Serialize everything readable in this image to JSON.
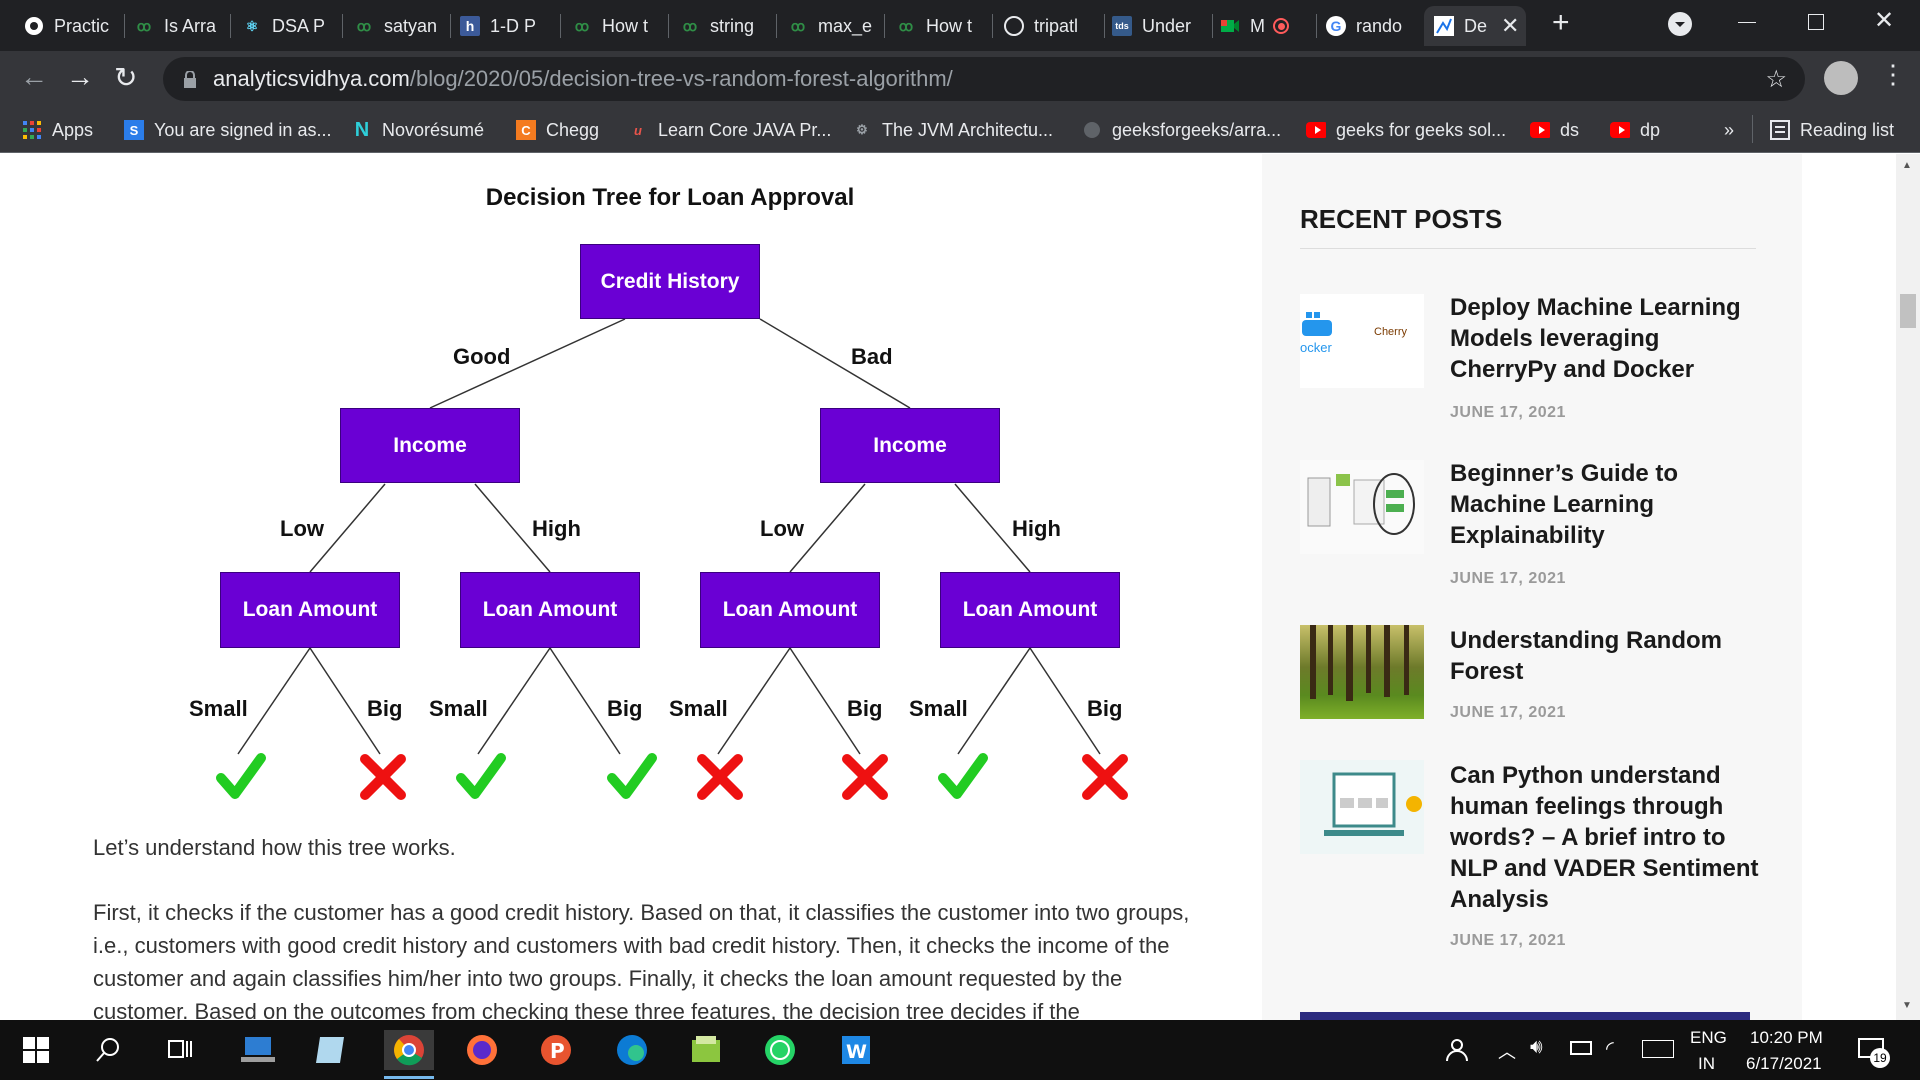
{
  "tabs": [
    {
      "label": "Practic",
      "icon": "globe-icon"
    },
    {
      "label": "Is Arra",
      "icon": "gfg-icon"
    },
    {
      "label": "DSA P",
      "icon": "react-icon"
    },
    {
      "label": "satyan",
      "icon": "gfg-icon"
    },
    {
      "label": "1-D P",
      "icon": "h-icon"
    },
    {
      "label": "How t",
      "icon": "gfg-icon"
    },
    {
      "label": "string",
      "icon": "gfg-icon"
    },
    {
      "label": "max_e",
      "icon": "gfg-icon"
    },
    {
      "label": "How t",
      "icon": "gfg-icon"
    },
    {
      "label": "tripatl",
      "icon": "github-icon"
    },
    {
      "label": "Under",
      "icon": "tds-icon"
    },
    {
      "label": "M",
      "icon": "meet-icon"
    },
    {
      "label": "rando",
      "icon": "google-icon"
    },
    {
      "label": "De",
      "icon": "analytics-icon"
    }
  ],
  "new_tab_symbol": "+",
  "url": {
    "host": "analyticsvidhya.com",
    "path": "/blog/2020/05/decision-tree-vs-random-forest-algorithm/"
  },
  "bookmarks": [
    {
      "label": "Apps"
    },
    {
      "label": "You are signed in as..."
    },
    {
      "label": "Novorésumé"
    },
    {
      "label": "Chegg"
    },
    {
      "label": "Learn Core JAVA Pr..."
    },
    {
      "label": "The JVM Architectu..."
    },
    {
      "label": "geeksforgeeks/arra..."
    },
    {
      "label": "geeks for geeks sol..."
    },
    {
      "label": "ds"
    },
    {
      "label": "dp"
    }
  ],
  "bookmarks_overflow": "»",
  "reading_list": "Reading list",
  "diagram": {
    "title": "Decision Tree for Loan Approval",
    "root": "Credit History",
    "edge_good": "Good",
    "edge_bad": "Bad",
    "income": "Income",
    "low": "Low",
    "high": "High",
    "loan_amount": "Loan Amount",
    "small": "Small",
    "big": "Big",
    "outcomes": [
      "approve",
      "reject",
      "approve",
      "approve",
      "reject",
      "reject",
      "approve",
      "reject"
    ],
    "colors": {
      "node": "#6a00d4",
      "approve": "#22cc22",
      "reject": "#ee1111"
    }
  },
  "article": {
    "para1": "Let’s understand how this tree works.",
    "para2": "First, it checks if the customer has a good credit history. Based on that, it classifies the customer into two groups, i.e., customers with good credit history and customers with bad credit history. Then, it checks the income of the customer and again classifies him/her into two groups. Finally, it checks the loan amount requested by the customer. Based on the outcomes from checking these three features, the decision tree decides if the"
  },
  "sidebar": {
    "heading": "RECENT POSTS",
    "posts": [
      {
        "title": "Deploy Machine Learning Models leveraging CherryPy and Docker",
        "date": "JUNE 17, 2021",
        "thumb_text_1": "ocker",
        "thumb_text_2": "Cherry"
      },
      {
        "title": "Beginner’s Guide to Machine Learning Explainability",
        "date": "JUNE 17, 2021"
      },
      {
        "title": "Understanding Random Forest",
        "date": "JUNE 17, 2021"
      },
      {
        "title": "Can Python understand human feelings through words? – A brief intro to NLP and VADER Sentiment Analysis",
        "date": "JUNE 17, 2021"
      }
    ]
  },
  "taskbar": {
    "lang_top": "ENG",
    "lang_bottom": "IN",
    "time": "10:20 PM",
    "date": "6/17/2021",
    "notifications": "19"
  }
}
